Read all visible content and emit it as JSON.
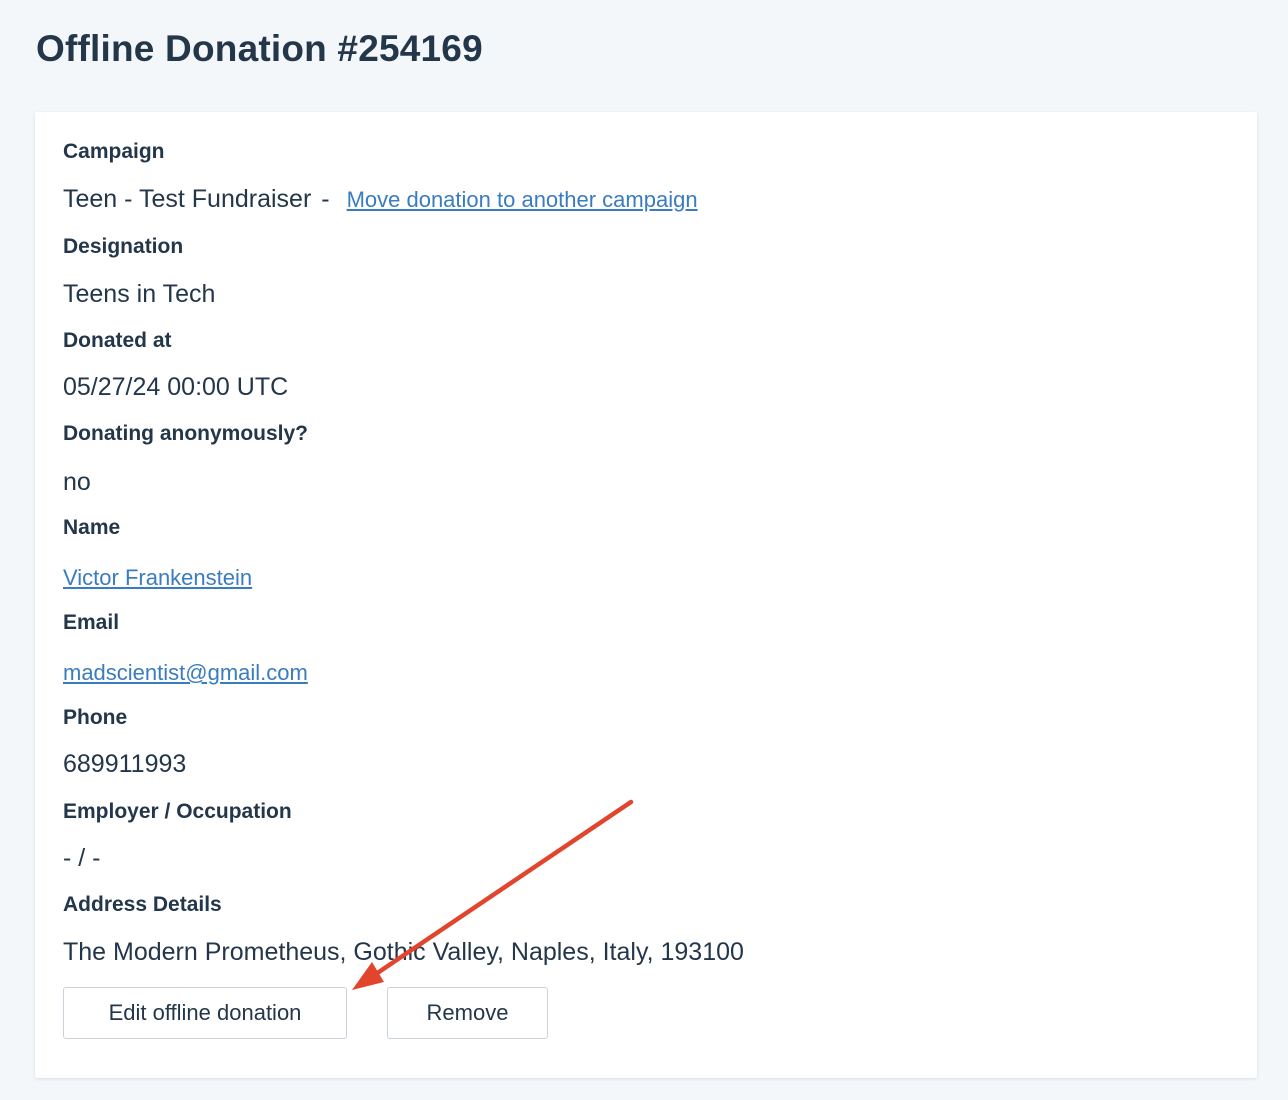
{
  "page": {
    "title": "Offline Donation #254169"
  },
  "fields": {
    "campaign": {
      "label": "Campaign",
      "value": "Teen - Test Fundraiser",
      "separator": "-",
      "move_link": "Move donation to another campaign"
    },
    "designation": {
      "label": "Designation",
      "value": "Teens in Tech"
    },
    "donated_at": {
      "label": "Donated at",
      "value": "05/27/24 00:00 UTC"
    },
    "anonymous": {
      "label": "Donating anonymously?",
      "value": "no"
    },
    "name": {
      "label": "Name",
      "value": "Victor Frankenstein"
    },
    "email": {
      "label": "Email",
      "value": "madscientist@gmail.com"
    },
    "phone": {
      "label": "Phone",
      "value": "689911993"
    },
    "employer": {
      "label": "Employer / Occupation",
      "value": "- / -"
    },
    "address": {
      "label": "Address Details",
      "value": "The Modern Prometheus, Gothic Valley, Naples, Italy, 193100"
    }
  },
  "actions": {
    "edit_label": "Edit offline donation",
    "remove_label": "Remove"
  },
  "colors": {
    "background": "#f4f7fa",
    "text": "#24374a",
    "link": "#3a7cc0",
    "annotation_arrow": "#e2452e"
  }
}
